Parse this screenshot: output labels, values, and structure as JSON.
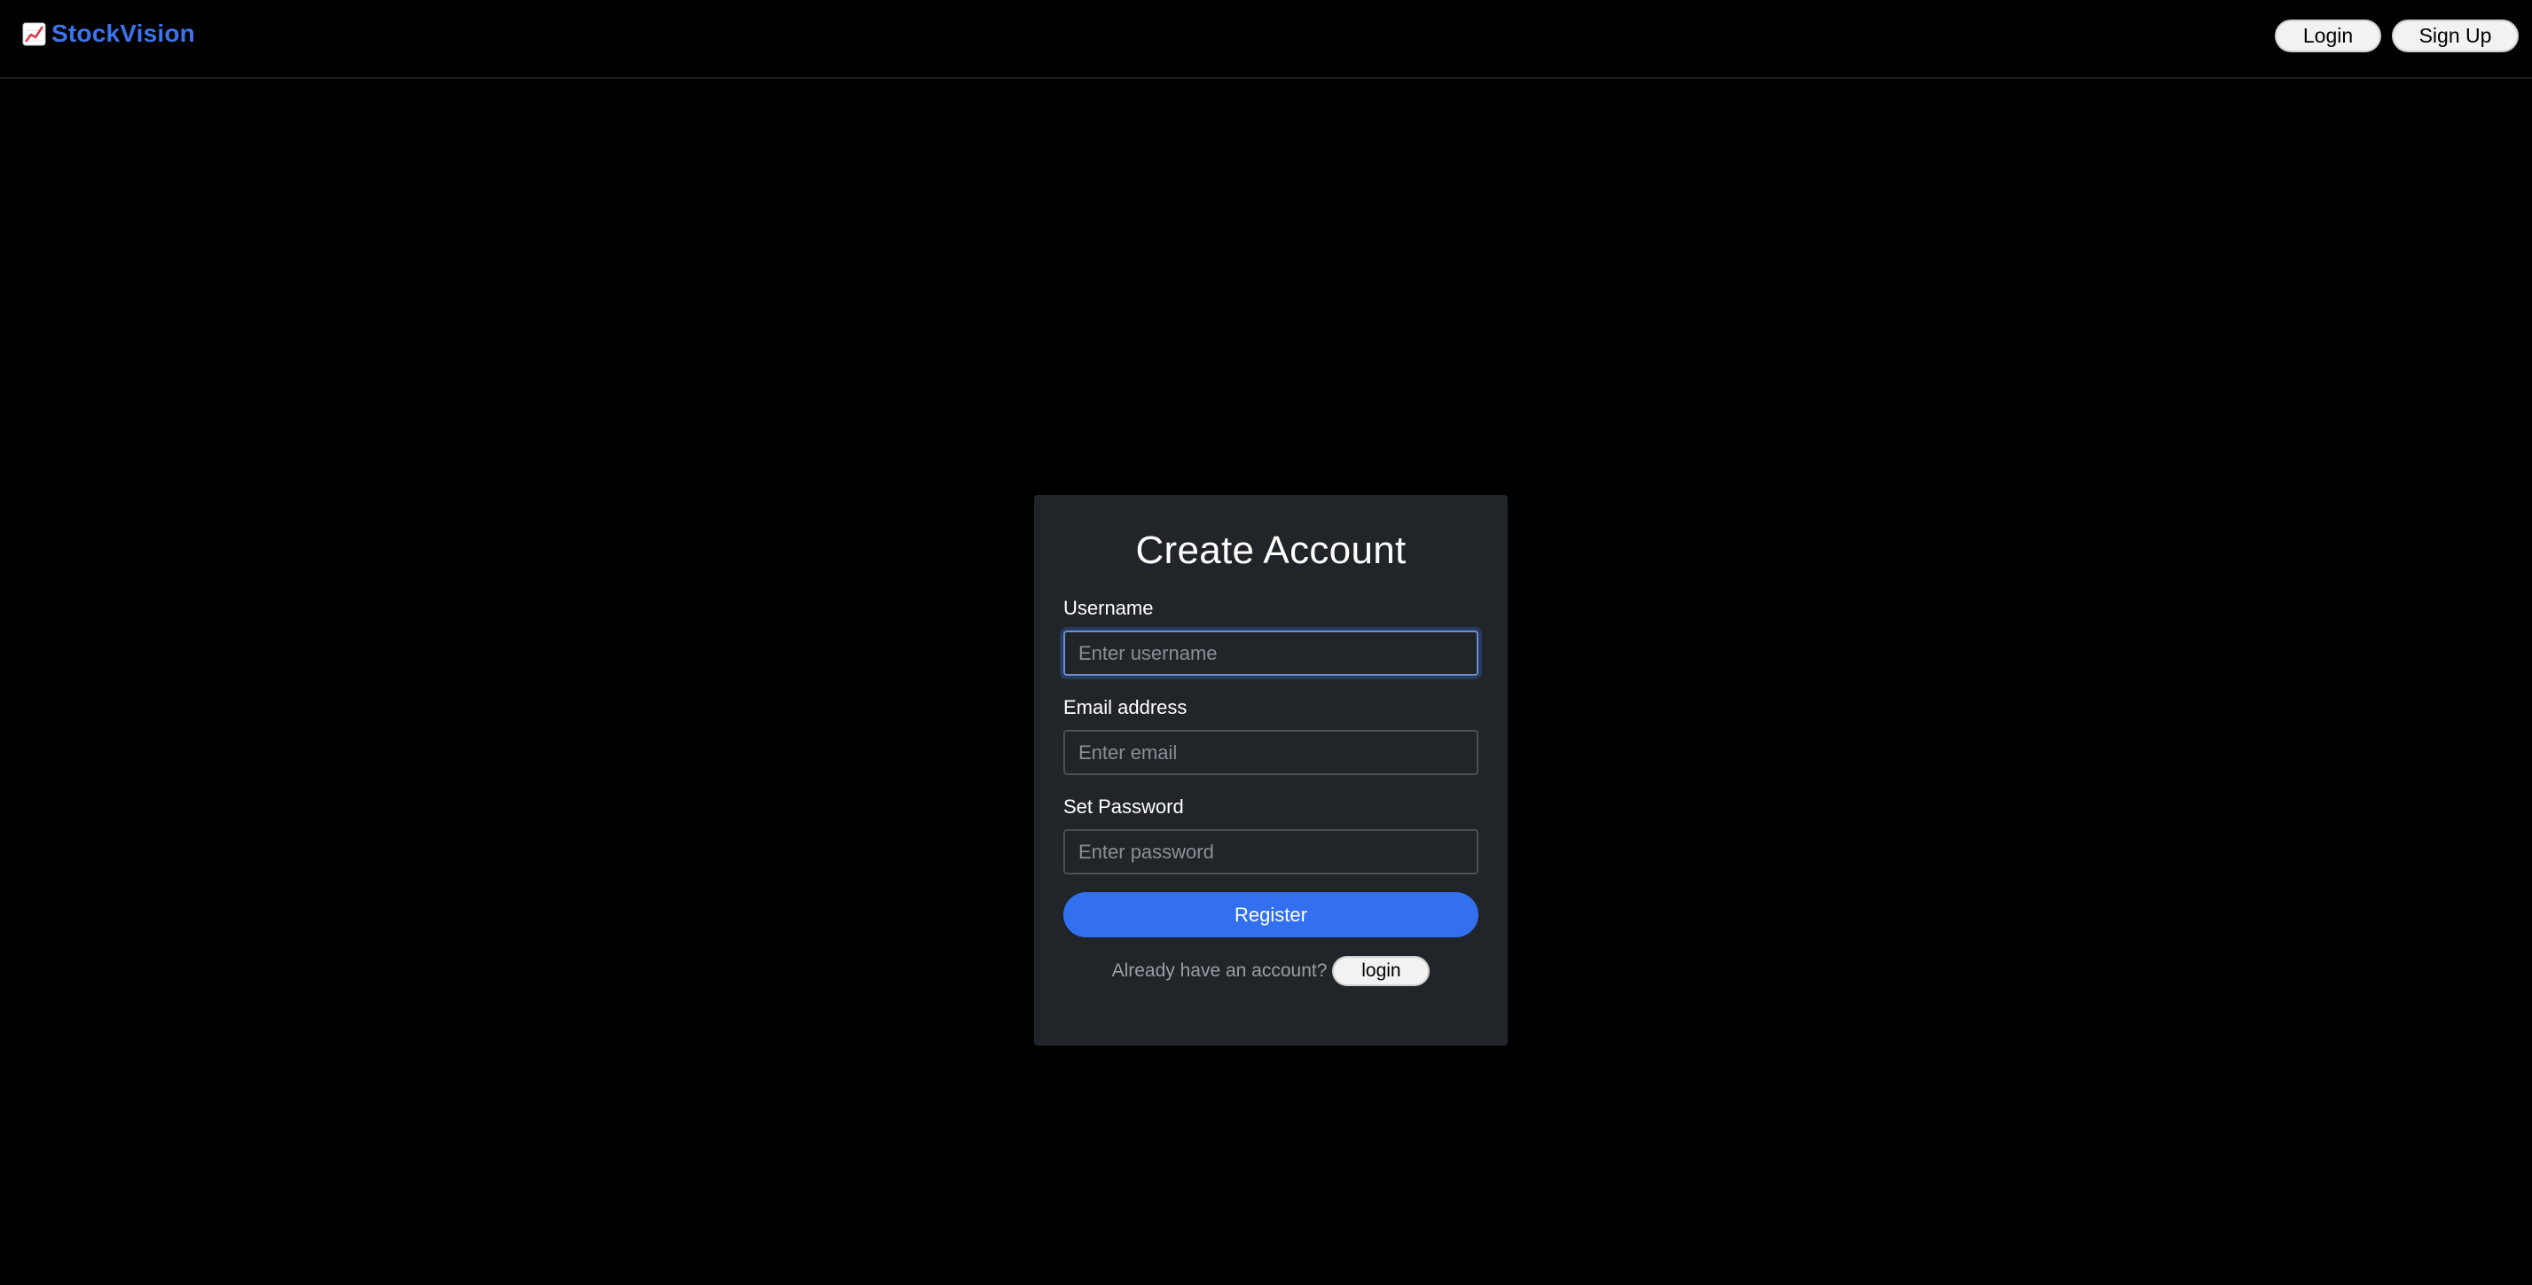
{
  "navbar": {
    "brand": {
      "icon": "chart-increasing-icon",
      "name": "StockVision",
      "color": "#3b74ee"
    },
    "login_label": "Login",
    "signup_label": "Sign Up"
  },
  "form": {
    "title": "Create Account",
    "username": {
      "label": "Username",
      "placeholder": "Enter username",
      "value": ""
    },
    "email": {
      "label": "Email address",
      "placeholder": "Enter email",
      "value": ""
    },
    "password": {
      "label": "Set Password",
      "placeholder": "Enter password",
      "value": ""
    },
    "register_label": "Register",
    "register_color": "#3370ef",
    "footer_text": "Already have an account?",
    "footer_login_label": "login"
  },
  "colors": {
    "background": "#000000",
    "card": "#212529"
  }
}
